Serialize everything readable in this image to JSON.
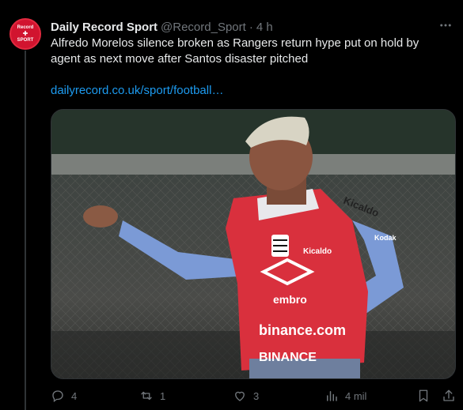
{
  "author": {
    "name": "Daily Record Sport",
    "handle": "@Record_Sport",
    "separator": "·",
    "time": "4 h",
    "avatar_text": [
      "Record",
      "✚",
      "SPORT"
    ]
  },
  "tweet": {
    "text": "Alfredo Morelos silence broken as Rangers return hype put on hold by agent as next move after Santos disaster pitched",
    "link": "dailyrecord.co.uk/sport/football…"
  },
  "media": {
    "shirt_texts": [
      "Kicaldo",
      "Kicaldo",
      "embro",
      "binance.com",
      "BINANCE",
      "Kodak"
    ]
  },
  "actions": {
    "replies": "4",
    "retweets": "1",
    "likes": "3",
    "views": "4 mil"
  },
  "colors": {
    "background": "#000000",
    "text": "#e7e9ea",
    "muted": "#71767b",
    "link": "#1d9bf0",
    "brand": "#d1142f"
  }
}
